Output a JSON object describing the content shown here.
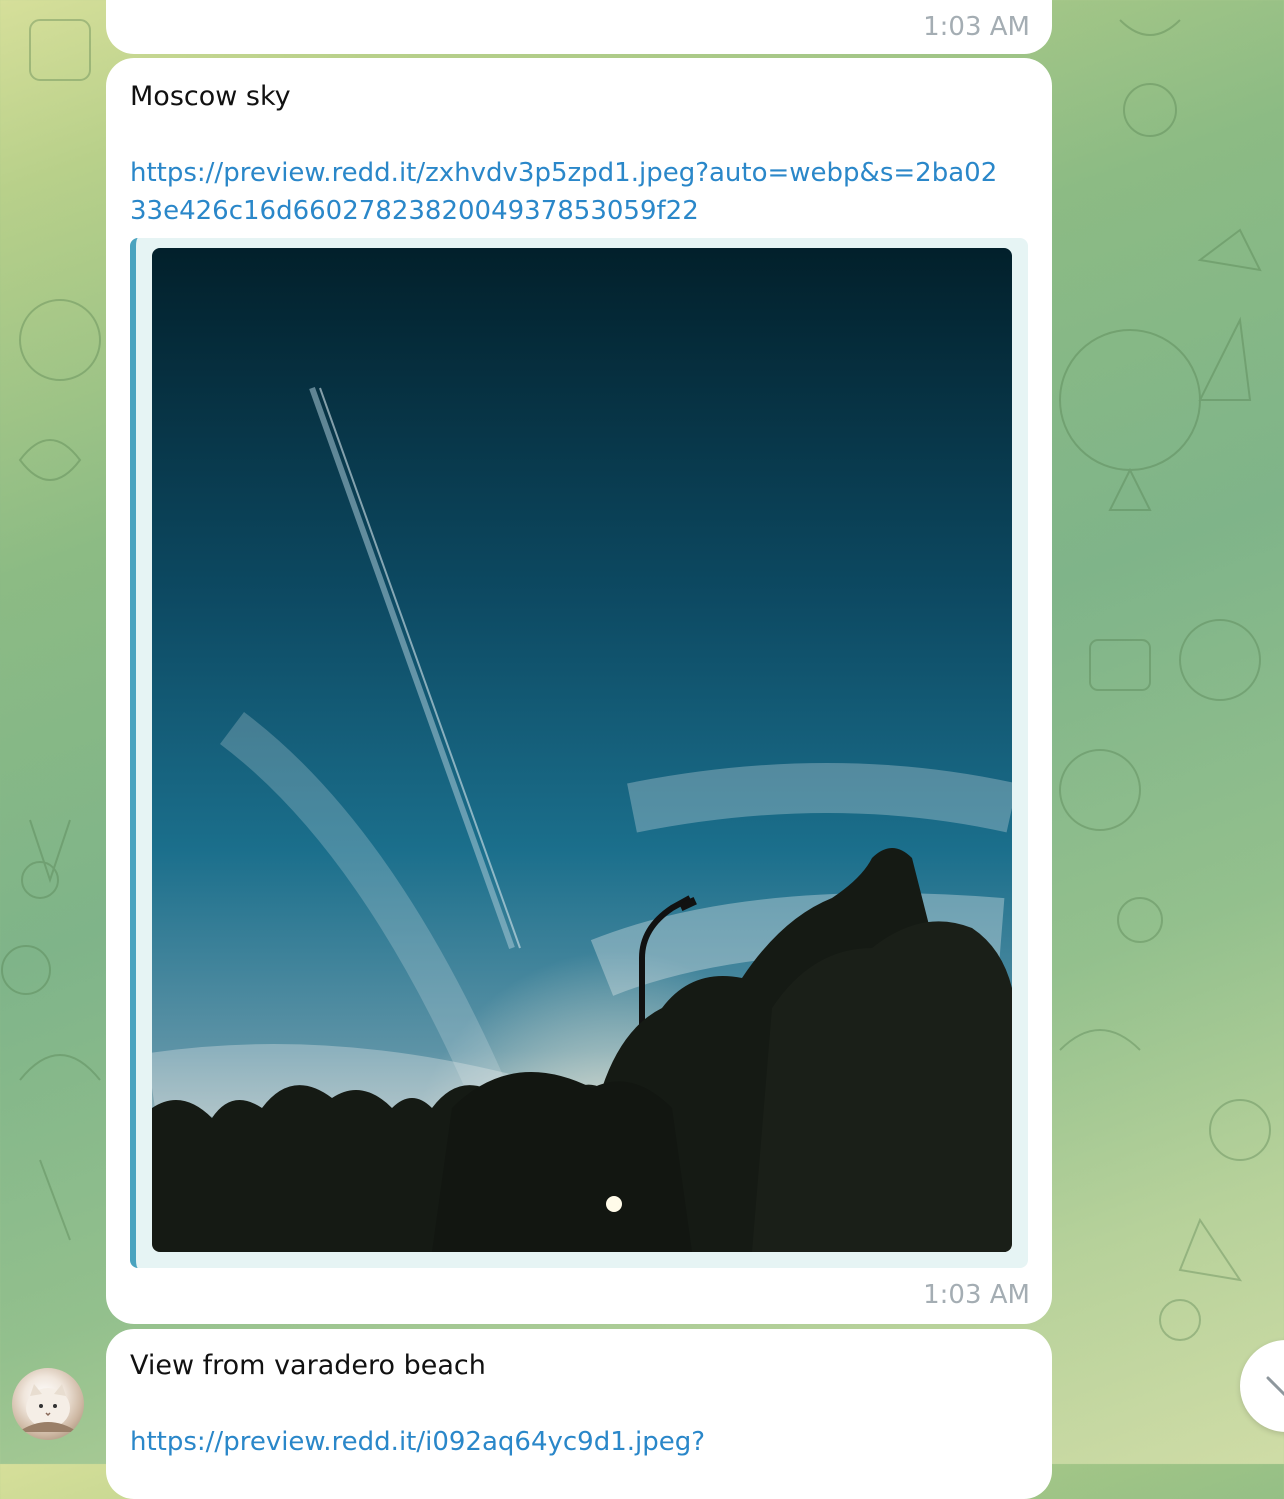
{
  "messages": [
    {
      "time": "1:03 AM"
    },
    {
      "text": "Moscow sky",
      "link": "https://preview.redd.it/zxhvdv3p5zpd1.jpeg?auto=webp&s=2ba0233e426c16d660278238200493785​3059f22",
      "time": "1:03 AM",
      "preview_image": "sky-photo"
    },
    {
      "text": "View from varadero beach",
      "link": "https://preview.redd.it/i092aq64yc9d1.jpeg?"
    }
  ],
  "colors": {
    "link": "#2a87c9",
    "timestamp": "#a4adb3",
    "preview_accent": "#4aa3bf"
  },
  "icons": {
    "scroll_down": "chevron-down-icon",
    "avatar": "cat-avatar"
  }
}
